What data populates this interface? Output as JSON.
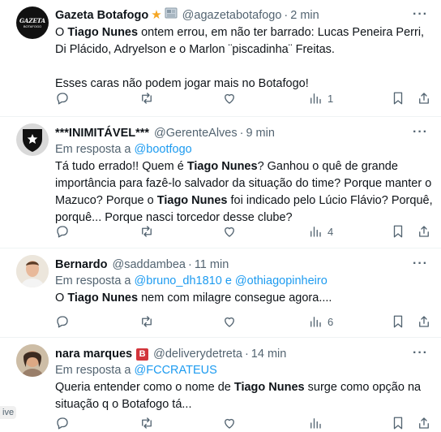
{
  "tweets": [
    {
      "name": "Gazeta Botafogo",
      "handle": "@agazetabotafogo",
      "sep": "·",
      "time": "2 min",
      "more": "···",
      "avatar_text": "GAZETA",
      "avatar_sub": "BOTAFOGO",
      "body": {
        "p1_a": "O ",
        "p1_b": "Tiago Nunes",
        "p1_c": " ontem errou, em não ter barrado: Lucas Peneira Perri, Di Plácido, Adryelson e o Marlon ¨piscadinha¨ Freitas.",
        "p2": "Esses caras não podem jogar mais no Botafogo!"
      },
      "views": "1"
    },
    {
      "name": "***INIMITÁVEL***",
      "handle": "@GerenteAlves",
      "sep": "·",
      "time": "9 min",
      "more": "···",
      "reply_prefix": "Em resposta a",
      "reply_to": "@bootfogo",
      "body": {
        "a": "Tá tudo errado!! Quem é ",
        "b": "Tiago Nunes",
        "c": "? Ganhou o quê de grande importância para fazê-lo salvador da situação do time? Porque manter o Mazuco? Porque o ",
        "d": "Tiago Nunes",
        "e": " foi indicado pelo Lúcio Flávio? Porquê, porquê... Porque nasci torcedor desse clube?"
      },
      "views": "4"
    },
    {
      "name": "Bernardo",
      "handle": "@saddambea",
      "sep": "·",
      "time": "11 min",
      "more": "···",
      "reply_prefix": "Em resposta a",
      "reply_to": "@bruno_dh1810 e @othiagopinheiro",
      "body": {
        "a": "O ",
        "b": "Tiago Nunes",
        "c": " nem com milagre consegue agora...."
      },
      "views": "6"
    },
    {
      "name": "nara marques",
      "badge": "B",
      "handle": "@deliverydetreta",
      "sep": "·",
      "time": "14 min",
      "more": "···",
      "reply_prefix": "Em resposta a",
      "reply_to": "@FCCRATEUS",
      "body": {
        "a": "Queria entender como o nome de ",
        "b": "Tiago Nunes",
        "c": " surge como opção na situação q o Botafogo tá..."
      }
    }
  ],
  "edge_tab": "ive",
  "colors": {
    "link": "#1d9bf0",
    "muted": "#536471",
    "text": "#0f1419",
    "star": "#f5a623",
    "badge": "#d2343b"
  },
  "icons": [
    "reply-icon",
    "retweet-icon",
    "like-icon",
    "views-icon",
    "bookmark-icon",
    "share-icon",
    "star-icon",
    "newspaper-icon"
  ]
}
